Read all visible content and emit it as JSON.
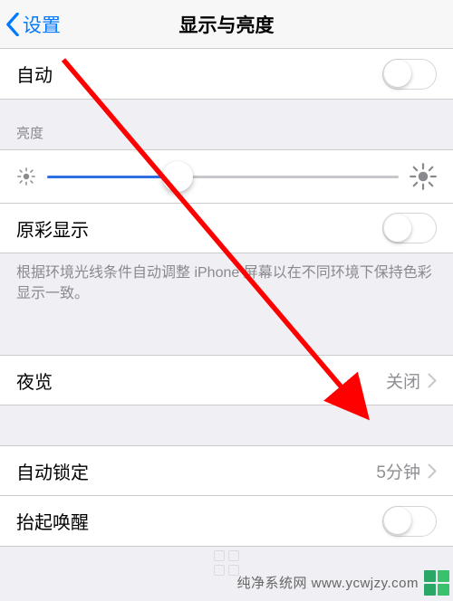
{
  "nav": {
    "back_label": "设置",
    "title": "显示与亮度"
  },
  "rows": {
    "auto_brightness": "自动",
    "true_tone": "原彩显示",
    "night_shift_label": "夜览",
    "night_shift_value": "关闭",
    "auto_lock_label": "自动锁定",
    "auto_lock_value": "5分钟",
    "raise_to_wake": "抬起唤醒"
  },
  "sections": {
    "brightness_header": "亮度",
    "true_tone_footer": "根据环境光线条件自动调整 iPhone 屏幕以在不同环境下保持色彩显示一致。"
  },
  "watermark": {
    "text": "纯净系统网 www.ycwjzy.com"
  }
}
